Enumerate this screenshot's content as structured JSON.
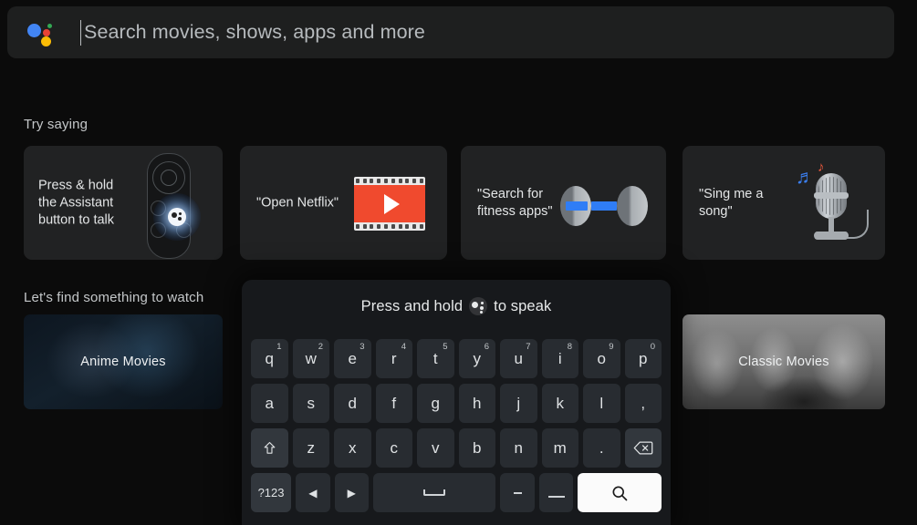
{
  "search": {
    "placeholder": "Search movies, shows, apps and more",
    "assistant_icon": "google-assistant-icon",
    "colors": {
      "blue": "#4285F4",
      "red": "#EA4335",
      "yellow": "#FBBC05",
      "green": "#34A853"
    }
  },
  "try_saying": {
    "heading": "Try saying",
    "cards": [
      {
        "label": "Press & hold the Assistant button to talk",
        "art": "tv-remote-assistant-icon"
      },
      {
        "label": "\"Open Netflix\"",
        "art": "film-strip-play-icon"
      },
      {
        "label": "\"Search for fitness apps\"",
        "art": "dumbbell-icon"
      },
      {
        "label": "\"Sing me a song\"",
        "art": "microphone-music-note-icon"
      }
    ]
  },
  "watch": {
    "heading": "Let's find something to watch",
    "tiles": [
      {
        "label": "Anime Movies"
      },
      {
        "label": "Classic Movies"
      }
    ]
  },
  "keyboard": {
    "hint_prefix": "Press and hold",
    "hint_suffix": "to speak",
    "hint_icon": "google-assistant-icon",
    "rows": [
      [
        {
          "label": "q",
          "sup": "1"
        },
        {
          "label": "w",
          "sup": "2"
        },
        {
          "label": "e",
          "sup": "3"
        },
        {
          "label": "r",
          "sup": "4"
        },
        {
          "label": "t",
          "sup": "5"
        },
        {
          "label": "y",
          "sup": "6"
        },
        {
          "label": "u",
          "sup": "7"
        },
        {
          "label": "i",
          "sup": "8"
        },
        {
          "label": "o",
          "sup": "9"
        },
        {
          "label": "p",
          "sup": "0"
        }
      ],
      [
        {
          "label": "a"
        },
        {
          "label": "s"
        },
        {
          "label": "d"
        },
        {
          "label": "f"
        },
        {
          "label": "g"
        },
        {
          "label": "h"
        },
        {
          "label": "j"
        },
        {
          "label": "k"
        },
        {
          "label": "l"
        },
        {
          "label": ","
        }
      ],
      [
        {
          "label": "",
          "icon": "shift-icon"
        },
        {
          "label": "z"
        },
        {
          "label": "x"
        },
        {
          "label": "c"
        },
        {
          "label": "v"
        },
        {
          "label": "b"
        },
        {
          "label": "n"
        },
        {
          "label": "m"
        },
        {
          "label": "."
        },
        {
          "label": "",
          "icon": "backspace-icon"
        }
      ],
      [
        {
          "label": "?123"
        },
        {
          "label": "",
          "icon": "arrow-left-icon"
        },
        {
          "label": "",
          "icon": "arrow-right-icon"
        },
        {
          "label": "",
          "icon": "space-icon"
        },
        {
          "label": "",
          "icon": "hyphen-icon"
        },
        {
          "label": "",
          "icon": "underscore-icon"
        },
        {
          "label": "",
          "icon": "search-icon"
        }
      ]
    ]
  }
}
